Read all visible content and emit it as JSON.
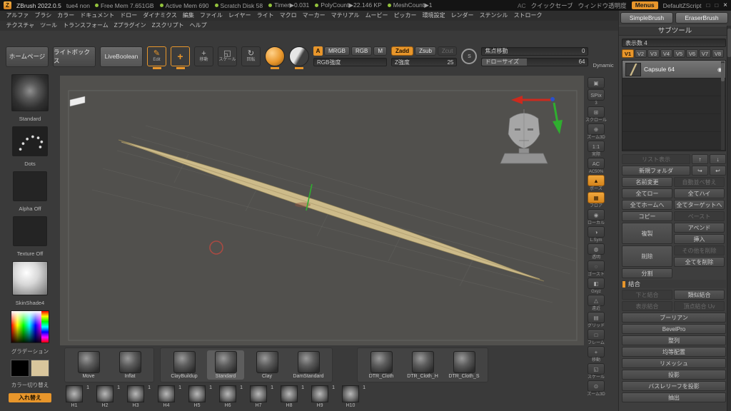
{
  "colors": {
    "accent": "#e8962b",
    "mesh": "#cdbb8a",
    "gizmo_green": "#2fae2f",
    "cursor_red": "#a84a42"
  },
  "titlebar": {
    "app_title": "ZBrush 2022.0.5",
    "session": "tue4 non",
    "stats": [
      "Free Mem 7.651GB",
      "Active Mem 690",
      "Scratch Disk 58",
      "Timer▶0.031",
      "PolyCount▶22.146 KP",
      "MeshCount▶1"
    ],
    "ac_label": "AC",
    "quick_save": "クイックセーブ",
    "window_opacity": "ウィンドウ透明度",
    "menus_button": "Menus",
    "zscript": "DefaultZScript",
    "close": "×"
  },
  "menu_row1": [
    "アルファ",
    "ブラシ",
    "カラー",
    "ドキュメント",
    "ドロー",
    "ダイナミクス",
    "編集",
    "ファイル",
    "レイヤー",
    "ライト",
    "マクロ",
    "マーカー",
    "マテリアル",
    "ムービー",
    "ピッカー",
    "環境設定",
    "レンダー",
    "ステンシル",
    "ストローク"
  ],
  "menu_row2": [
    "テクスチャ",
    "ツール",
    "トランスフォーム",
    "Zプラグイン",
    "Zスクリプト",
    "ヘルプ"
  ],
  "top_right_brushes": [
    "SimpleBrush",
    "EraserBrush"
  ],
  "toolbar": {
    "homepage": "ホームページ",
    "lightbox": "ライトボックス",
    "liveboolean": "LiveBoolean",
    "edit_label": "Edit",
    "move_label": "移動",
    "scale_label": "スケール",
    "rotate_label": "回転",
    "a_toggle": "A",
    "mrgb": "MRGB",
    "rgb": "RGB",
    "m": "M",
    "zadd": "Zadd",
    "zsub": "Zsub",
    "zcut": "Zcut",
    "rgb_intensity_label": "RGB強度",
    "z_intensity_label": "Z強度",
    "z_intensity_value": "25",
    "focal_label": "焦点移動",
    "focal_value": "0",
    "draw_size_label": "ドローサイズ",
    "draw_size_value": "64",
    "dynamic_label": "Dynamic"
  },
  "left_shelf": {
    "brush_label": "Standard",
    "stroke_label": "Dots",
    "alpha_label": "Alpha Off",
    "texture_label": "Texture Off",
    "material_label": "SkinShade4",
    "gradient_label": "グラデーション",
    "color_switch_label": "カラー切り替え",
    "swap_button": "入れ替え",
    "primary_color": "#000000",
    "secondary_color": "#d9c69c"
  },
  "right_strip": [
    {
      "name": "bpr-render-button",
      "glyph": "▣",
      "label": ""
    },
    {
      "name": "spix-slider",
      "glyph": "SPix",
      "label": "3"
    },
    {
      "name": "scroll-canvas-button",
      "glyph": "⊞",
      "label": "スクロール"
    },
    {
      "name": "zoom-canvas-button",
      "glyph": "⊕",
      "label": "ズーム3D"
    },
    {
      "name": "actual-size-button",
      "glyph": "1:1",
      "label": "実際"
    },
    {
      "name": "half-size-button",
      "glyph": "AC",
      "label": "AC50%"
    },
    {
      "name": "pose-button",
      "glyph": "▲",
      "label": "ポーズ",
      "active": true
    },
    {
      "name": "floor-grid-button",
      "glyph": "▦",
      "label": "フロア",
      "active": true
    },
    {
      "name": "local-transform-button",
      "glyph": "◉",
      "label": "ローカル"
    },
    {
      "name": "local-symmetry-button",
      "glyph": "◑",
      "label": "L.Sym"
    },
    {
      "name": "transparency-button",
      "glyph": "◍",
      "label": "透明"
    },
    {
      "name": "ghost-button",
      "glyph": "◌",
      "label": "ゴースト"
    },
    {
      "name": "gxyz-button",
      "glyph": "◧",
      "label": "Gxyz"
    },
    {
      "name": "perspective-button",
      "glyph": "△",
      "label": "遠近"
    },
    {
      "name": "grid-button",
      "glyph": "▤",
      "label": "グリッド"
    },
    {
      "name": "frame-button",
      "glyph": "□",
      "label": "フレーム"
    },
    {
      "name": "move-canvas-button",
      "glyph": "+",
      "label": "移動"
    },
    {
      "name": "scale-canvas-button",
      "glyph": "◱",
      "label": "スケール"
    },
    {
      "name": "zoom3d-button",
      "glyph": "⊙",
      "label": "ズーム3D"
    }
  ],
  "subtool": {
    "title": "サブツール",
    "display_count": "表示数 4",
    "tabs": [
      "V1",
      "V2",
      "V3",
      "V4",
      "V5",
      "V6",
      "V7",
      "V8"
    ],
    "active_tab": "V1",
    "items": [
      {
        "name": "Capsule 64"
      }
    ],
    "rows": [
      {
        "type": "triple",
        "a": "リスト表示",
        "aDisabled": true,
        "b": "↑",
        "c": "↓"
      },
      {
        "type": "triple",
        "a": "新規フォルダ",
        "b": "↪",
        "c": "↩"
      },
      {
        "type": "pair",
        "a": "名前変更",
        "b": "自動並べ替え",
        "bDisabled": true
      },
      {
        "type": "pair",
        "a": "全てロー",
        "b": "全てハイ"
      },
      {
        "type": "pair",
        "a": "全てホームへ",
        "b": "全てターゲットへ"
      },
      {
        "type": "pair",
        "a": "コピー",
        "b": "ペースト",
        "bDisabled": true
      },
      {
        "type": "tallpair",
        "a": "複製",
        "b1": "アペンド",
        "b2": "挿入"
      },
      {
        "type": "tallpair",
        "a": "削除",
        "b1": "その他を削除",
        "b1Disabled": true,
        "b2": "全てを削除"
      },
      {
        "type": "half",
        "a": "分割"
      },
      {
        "type": "section",
        "a": "結合"
      },
      {
        "type": "pair",
        "a": "下と結合",
        "aDisabled": true,
        "b": "類似結合"
      },
      {
        "type": "pair",
        "a": "表示結合",
        "aDisabled": true,
        "b": "頂点結合 Uv",
        "bDisabled": true
      },
      {
        "type": "full",
        "a": "ブーリアン"
      },
      {
        "type": "full",
        "a": "BevelPro"
      },
      {
        "type": "full",
        "a": "整列"
      },
      {
        "type": "full",
        "a": "均等配置"
      },
      {
        "type": "full",
        "a": "リメッシュ"
      },
      {
        "type": "full",
        "a": "投影"
      },
      {
        "type": "full",
        "a": "バスレリーフを投影"
      },
      {
        "type": "full",
        "a": "抽出"
      }
    ]
  },
  "brush_tray": {
    "groups": [
      {
        "items": [
          {
            "label": "Move"
          },
          {
            "label": "Inflat"
          }
        ]
      },
      {
        "items": [
          {
            "label": "ClayBuildup"
          },
          {
            "label": "Standard",
            "active": true
          },
          {
            "label": "Clay"
          },
          {
            "label": "DamStandard"
          }
        ]
      },
      {
        "items": [
          {
            "label": "DTR_Cloth"
          },
          {
            "label": "DTR_Cloth_H"
          },
          {
            "label": "DTR_Cloth_S"
          }
        ]
      }
    ]
  },
  "alpha_tray": {
    "items": [
      {
        "label": "H1",
        "count": "1"
      },
      {
        "label": "H2",
        "count": "1"
      },
      {
        "label": "H3",
        "count": "1"
      },
      {
        "label": "H4",
        "count": "1"
      },
      {
        "label": "H5",
        "count": "1"
      },
      {
        "label": "H6",
        "count": "1"
      },
      {
        "label": "H7",
        "count": "1"
      },
      {
        "label": "H8",
        "count": "1"
      },
      {
        "label": "H9",
        "count": "1"
      },
      {
        "label": "H10",
        "count": "1"
      }
    ]
  }
}
